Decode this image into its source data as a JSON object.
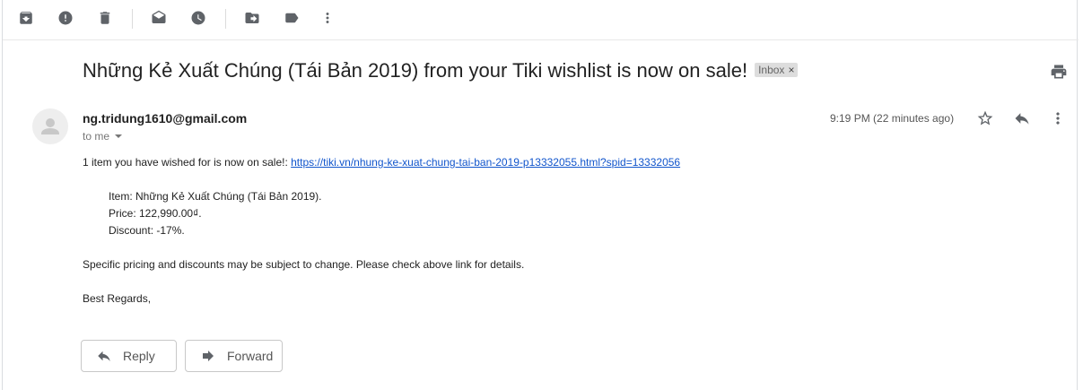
{
  "toolbar": {
    "icons": [
      "archive-icon",
      "report-spam-icon",
      "delete-icon",
      "mark-unread-icon",
      "snooze-icon",
      "move-to-icon",
      "label-icon",
      "more-vert-icon"
    ]
  },
  "email": {
    "subject": "Những Kẻ Xuất Chúng (Tái Bản 2019) from your Tiki wishlist is now on sale!",
    "label": "Inbox",
    "label_remove": "×",
    "sender": "ng.tridung1610@gmail.com",
    "to": "to me",
    "time": "9:19 PM (22 minutes ago)",
    "intro": "1 item you have wished for is now on sale!: ",
    "link": "https://tiki.vn/nhung-ke-xuat-chung-tai-ban-2019-p13332055.html?spid=13332056",
    "item": "Item: Những Kẻ Xuất Chúng (Tái Bản 2019).",
    "price": "Price: 122,990.00₫.",
    "discount": "Discount: -17%.",
    "note": "Specific pricing and discounts may be subject to change. Please check above link for details.",
    "closing": "Best Regards,"
  },
  "actions": {
    "reply_label": "Reply",
    "forward_label": "Forward"
  },
  "colors": {
    "icon": "#5f6368",
    "link": "#1155cc",
    "chip_bg": "#dddddd"
  }
}
